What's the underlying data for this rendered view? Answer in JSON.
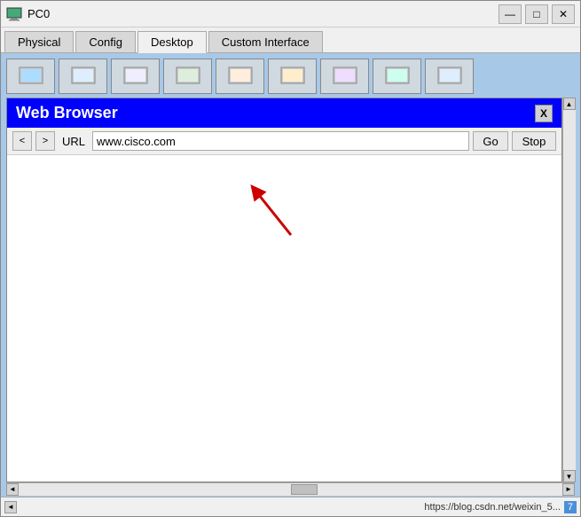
{
  "window": {
    "title": "PC0",
    "icon": "computer-icon"
  },
  "title_controls": {
    "minimize": "—",
    "maximize": "□",
    "close": "✕"
  },
  "tabs": [
    {
      "label": "Physical",
      "active": false
    },
    {
      "label": "Config",
      "active": false
    },
    {
      "label": "Desktop",
      "active": true
    },
    {
      "label": "Custom Interface",
      "active": false
    }
  ],
  "browser": {
    "title": "Web Browser",
    "close_label": "X",
    "back_label": "<",
    "forward_label": ">",
    "url_label": "URL",
    "url_value": "www.cisco.com",
    "go_label": "Go",
    "stop_label": "Stop"
  },
  "status_bar": {
    "url_text": "https://blog.csdn.net/weixin_5...",
    "page_num": "7"
  },
  "scroll": {
    "up_arrow": "▲",
    "down_arrow": "▼",
    "left_arrow": "◄",
    "right_arrow": "►"
  }
}
